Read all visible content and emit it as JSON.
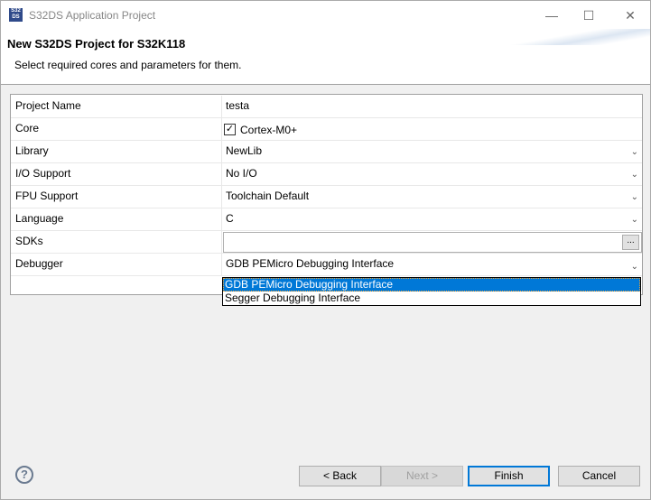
{
  "window": {
    "title": "S32DS Application Project",
    "icon_text": "S32DS",
    "min": "—",
    "max": "☐",
    "close": "✕"
  },
  "header": {
    "title": "New S32DS Project for S32K118",
    "subtitle": "Select required cores and parameters for them."
  },
  "rows": [
    {
      "label": "Project Name",
      "value": "testa"
    },
    {
      "label": "Core",
      "value": "Cortex-M0+"
    },
    {
      "label": "Library",
      "value": "NewLib"
    },
    {
      "label": "I/O Support",
      "value": "No I/O"
    },
    {
      "label": "FPU Support",
      "value": "Toolchain Default"
    },
    {
      "label": "Language",
      "value": "C"
    },
    {
      "label": "SDKs",
      "value": "",
      "browse": "..."
    },
    {
      "label": "Debugger",
      "value": "GDB PEMicro Debugging Interface"
    }
  ],
  "dropdown_options": [
    "GDB PEMicro Debugging Interface",
    "Segger Debugging Interface"
  ],
  "buttons": {
    "back": "< Back",
    "next": "Next >",
    "finish": "Finish",
    "cancel": "Cancel",
    "help": "?"
  }
}
